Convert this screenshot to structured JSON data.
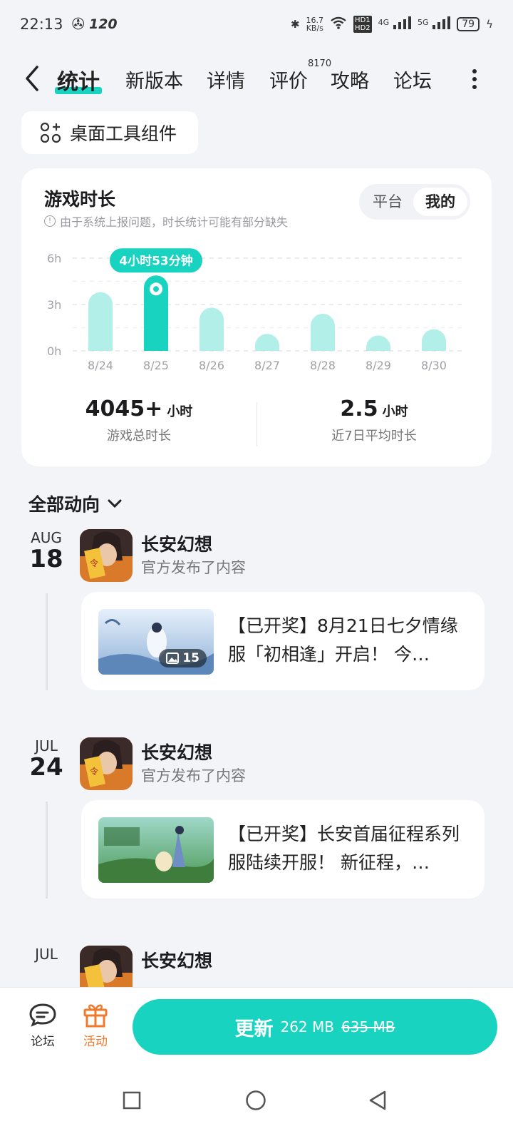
{
  "status_bar": {
    "time": "22:13",
    "refresh": "120",
    "net_speed_value": "16.7",
    "net_speed_unit": "KB/s",
    "hd1": "HD1",
    "hd2": "HD2",
    "net1": "4G",
    "net2": "5G",
    "battery": "79"
  },
  "nav": {
    "tabs": [
      "统计",
      "新版本",
      "详情",
      "评价",
      "攻略",
      "论坛"
    ],
    "active_tab": "统计",
    "review_badge": "8170"
  },
  "widget_button": {
    "label": "桌面工具组件"
  },
  "stats": {
    "title": "游戏时长",
    "note": "由于系统上报问题，时长统计可能有部分缺失",
    "segment": {
      "platform": "平台",
      "mine": "我的",
      "selected": "我的"
    },
    "tooltip": "4小时53分钟",
    "total": {
      "value": "4045+",
      "unit": "小时",
      "label": "游戏总时长"
    },
    "average": {
      "value": "2.5",
      "unit": "小时",
      "label": "近7日平均时长"
    }
  },
  "chart_data": {
    "type": "bar",
    "categories": [
      "8/24",
      "8/25",
      "8/26",
      "8/27",
      "8/28",
      "8/29",
      "8/30"
    ],
    "values": [
      3.8,
      4.88,
      2.8,
      1.1,
      2.4,
      1.0,
      1.4
    ],
    "yticks": [
      "6h",
      "3h",
      "0h"
    ],
    "ylim": [
      0,
      6
    ],
    "highlight_index": 1,
    "colors": {
      "bar": "#b3efe9",
      "highlight": "#18d3c0"
    }
  },
  "feed": {
    "header": "全部动向",
    "entries": [
      {
        "month": "AUG",
        "day": "18",
        "game": "长安幻想",
        "subtitle": "官方发布了内容",
        "post_text": "【已开奖】8月21日七夕情缘服「初相逢」开启！ 今…",
        "image_count": "15"
      },
      {
        "month": "JUL",
        "day": "24",
        "game": "长安幻想",
        "subtitle": "官方发布了内容",
        "post_text": "【已开奖】长安首届征程系列服陆续开服！ 新征程，…"
      },
      {
        "month": "JUL",
        "day": "",
        "game": "长安幻想",
        "subtitle": ""
      }
    ]
  },
  "bottom_bar": {
    "forum": "论坛",
    "activity": "活动",
    "update_label": "更新",
    "update_size": "262 MB",
    "full_size": "635 MB"
  },
  "colors": {
    "accent": "#18d3c0",
    "activity": "#f07a2c"
  }
}
